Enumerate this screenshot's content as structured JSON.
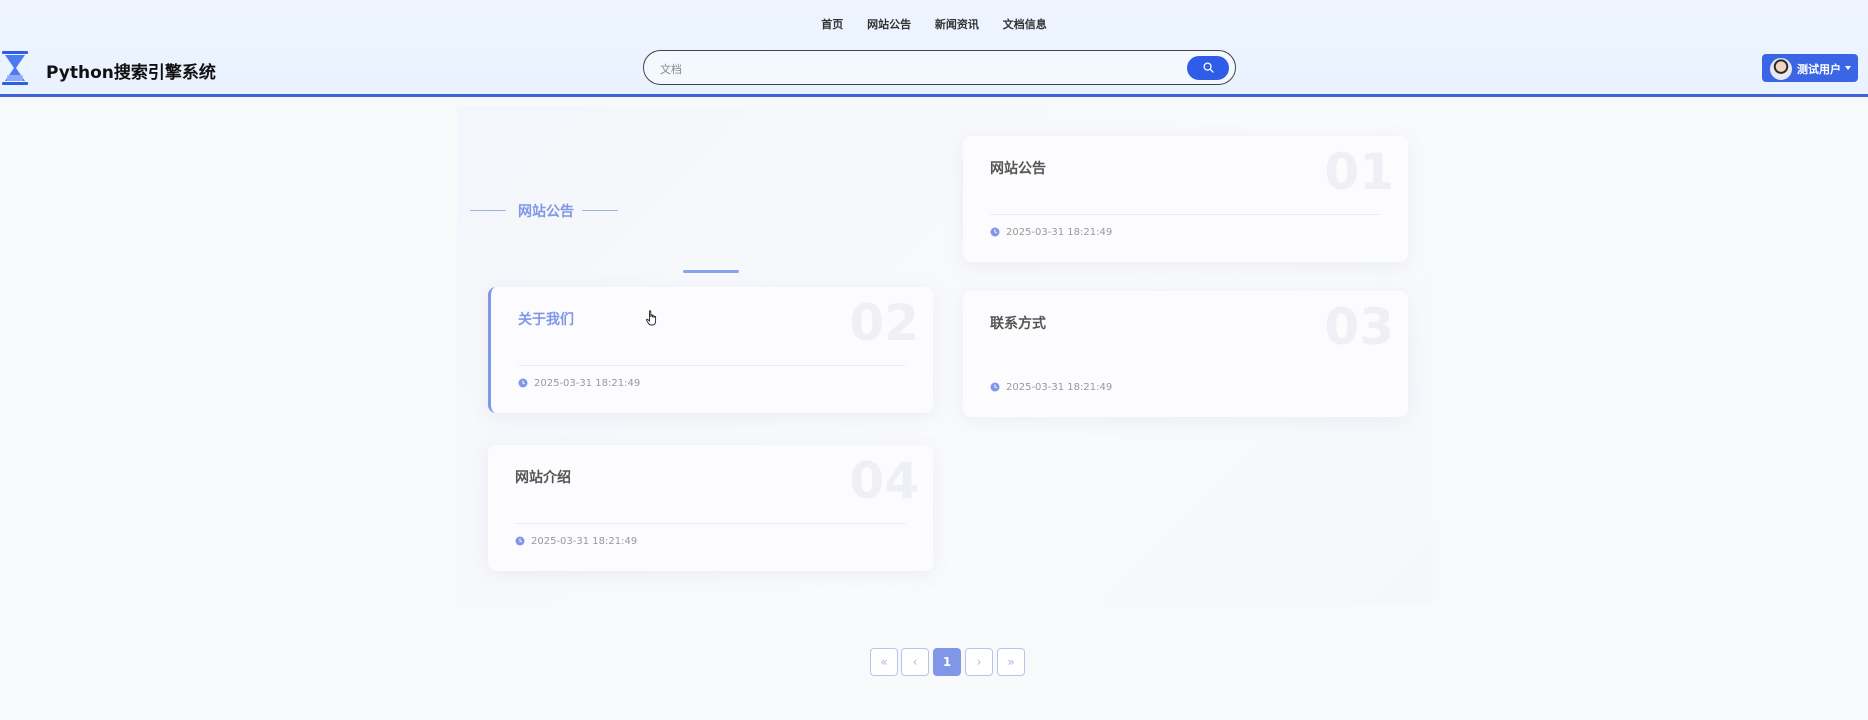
{
  "header": {
    "site_title": "Python搜索引擎系统",
    "nav": [
      "首页",
      "网站公告",
      "新闻资讯",
      "文档信息"
    ],
    "search_placeholder": "文档",
    "user_name": "测试用户"
  },
  "section": {
    "title": "网站公告"
  },
  "cards": [
    {
      "num": "01",
      "title": "网站公告",
      "date": "2025-03-31 18:21:49"
    },
    {
      "num": "02",
      "title": "关于我们",
      "date": "2025-03-31 18:21:49"
    },
    {
      "num": "03",
      "title": "联系方式",
      "date": "2025-03-31 18:21:49"
    },
    {
      "num": "04",
      "title": "网站介绍",
      "date": "2025-03-31 18:21:49"
    }
  ],
  "pagination": {
    "first": "«",
    "prev": "‹",
    "current": "1",
    "next": "›",
    "last": "»"
  },
  "colors": {
    "accent": "#3d62db",
    "soft_accent": "#7f97e6"
  }
}
